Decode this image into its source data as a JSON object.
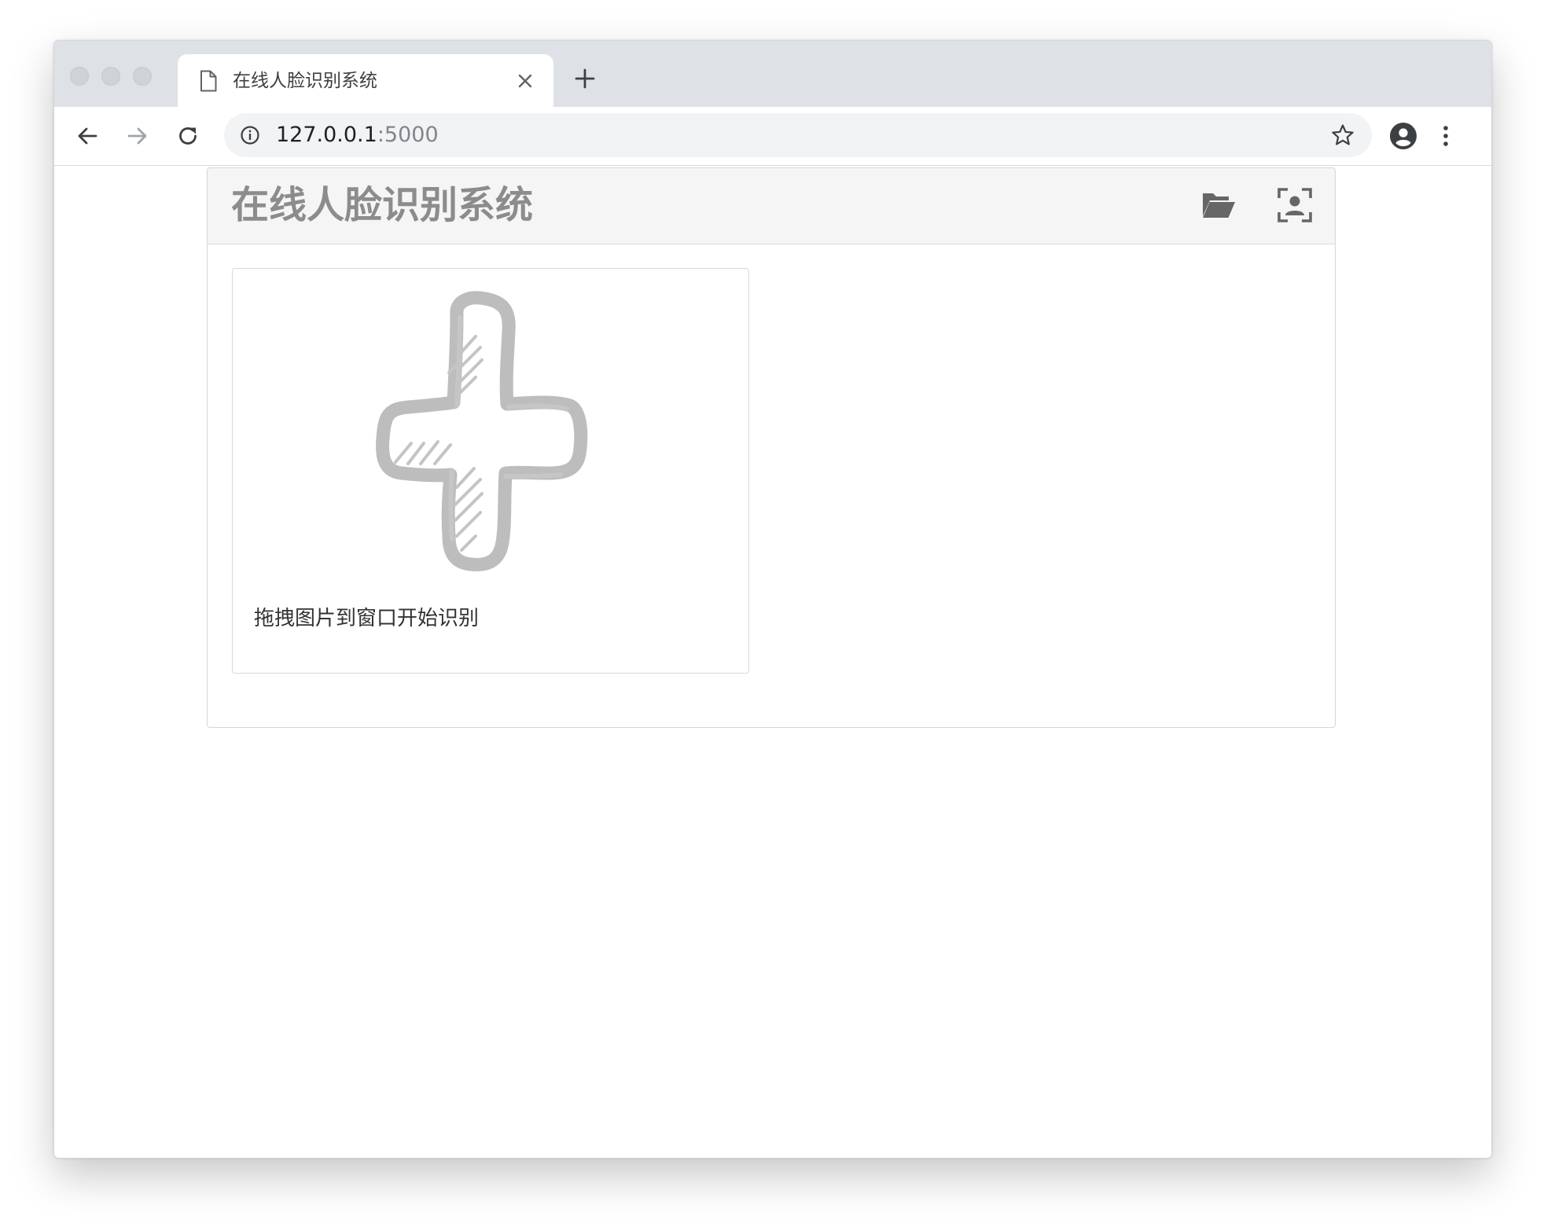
{
  "browser": {
    "tab": {
      "title": "在线人脸识别系统",
      "doc_icon": "document-icon",
      "close_icon": "close-icon"
    },
    "new_tab_icon": "plus-icon",
    "nav": {
      "back_icon": "arrow-left-icon",
      "forward_icon": "arrow-right-icon",
      "reload_icon": "reload-icon"
    },
    "address": {
      "host": "127.0.0.1",
      "port": ":5000",
      "info_icon": "info-icon",
      "bookmark_icon": "star-icon"
    },
    "profile_icon": "account-icon",
    "menu_icon": "more-vert-icon"
  },
  "app": {
    "title": "在线人脸识别系统",
    "header_icons": [
      "folder-open-icon",
      "face-scan-icon"
    ],
    "drop_zone": {
      "icon": "hand-drawn-plus-icon",
      "hint": "拖拽图片到窗口开始识别"
    }
  },
  "colors": {
    "tabstrip": "#dee1e6",
    "omnibox": "#f1f3f4",
    "app_header": "#f5f5f5",
    "app_title": "#8c8c8c",
    "icon_gray": "#666666",
    "plus_gray": "#bdbdbd"
  }
}
